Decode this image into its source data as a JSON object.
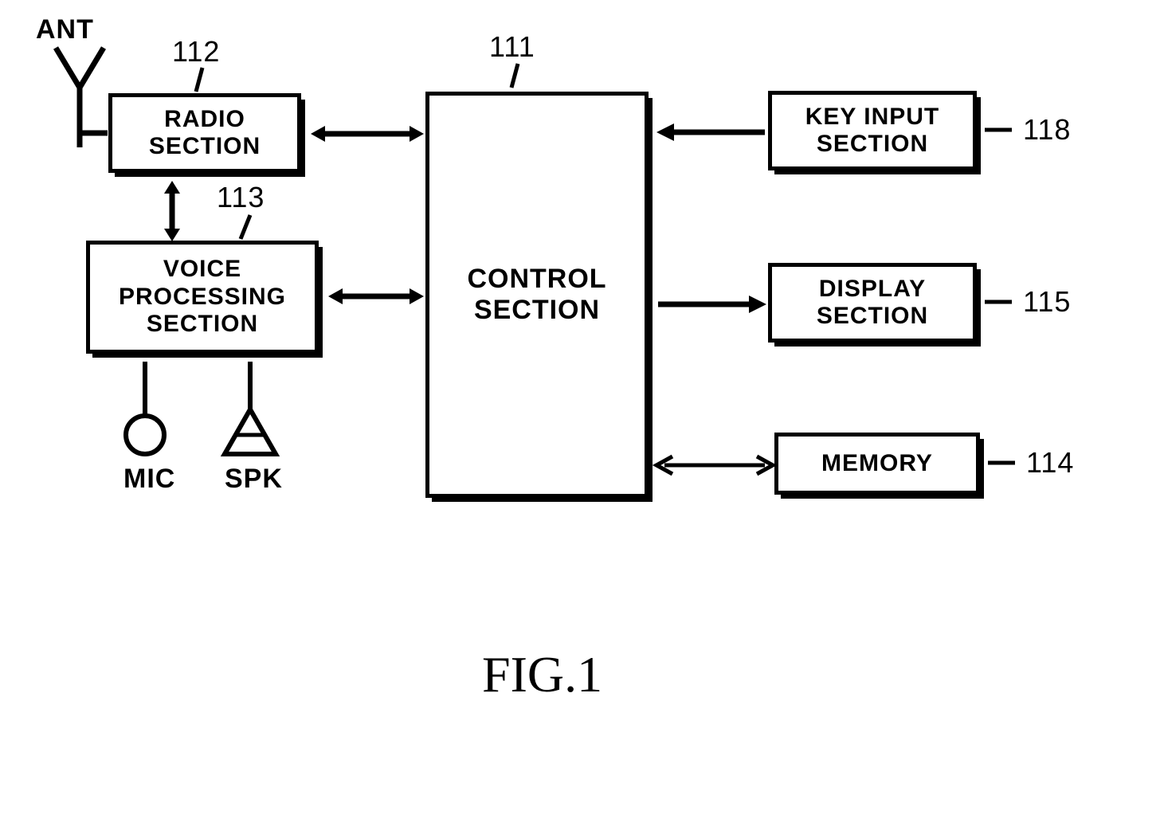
{
  "labels": {
    "ant": "ANT",
    "mic": "MIC",
    "spk": "SPK",
    "ref_112": "112",
    "ref_113": "113",
    "ref_111": "111",
    "ref_118": "118",
    "ref_115": "115",
    "ref_114": "114"
  },
  "blocks": {
    "radio": "RADIO\nSECTION",
    "voice": "VOICE\nPROCESSING\nSECTION",
    "control": "CONTROL\nSECTION",
    "keyinput": "KEY INPUT\nSECTION",
    "display": "DISPLAY\nSECTION",
    "memory": "MEMORY"
  },
  "caption": "FIG.1"
}
